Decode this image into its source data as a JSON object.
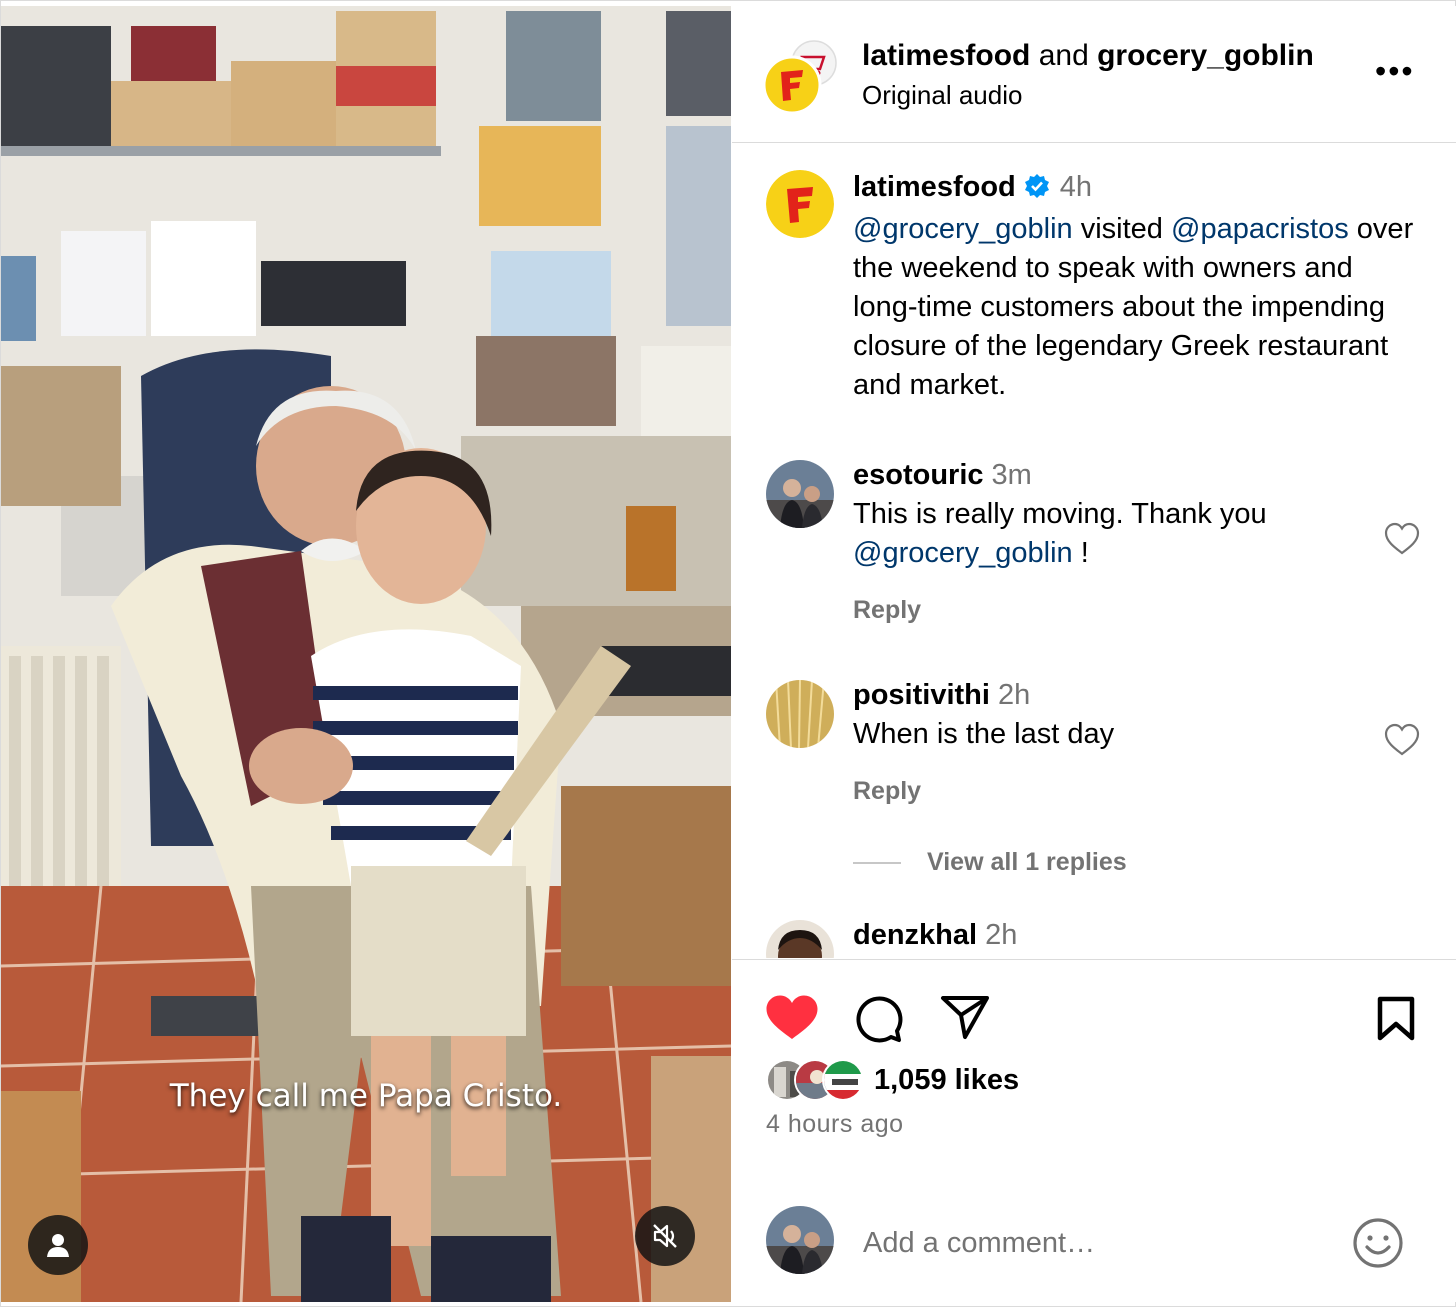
{
  "video": {
    "caption": "They call me Papa Cristo.",
    "user_icon": "person-icon",
    "mute_icon": "speaker-muted-icon"
  },
  "header": {
    "user1": "latimesfood",
    "joiner": " and ",
    "user2": "grocery_goblin",
    "audio": "Original audio",
    "more_label": "•••"
  },
  "post_caption": {
    "username": "latimesfood",
    "time": "4h",
    "mention1": "@grocery_goblin",
    "text1": " visited ",
    "mention2": "@papacristos",
    "text2": " over the weekend to speak with owners and long-time customers about the impending closure of the legendary Greek restaurant and market."
  },
  "comments": [
    {
      "username": "esotouric",
      "time": "3m",
      "text": "This is really moving. Thank you ",
      "mention": "@grocery_goblin",
      "text_after": " !",
      "reply": "Reply"
    },
    {
      "username": "positivithi",
      "time": "2h",
      "text": "When is the last day",
      "reply": "Reply"
    },
    {
      "username": "denzkhal",
      "time": "2h"
    }
  ],
  "view_replies": "View all 1 replies",
  "actions": {
    "likes": "1,059 likes",
    "time_ago": "4 hours ago",
    "add_comment_placeholder": "Add a comment…"
  },
  "colors": {
    "like_red": "#ff3040",
    "link_blue": "#00376b",
    "muted_grey": "#737373",
    "verified_blue": "#0095f6",
    "brand_yellow": "#f7d117",
    "brand_red": "#e2231a"
  }
}
